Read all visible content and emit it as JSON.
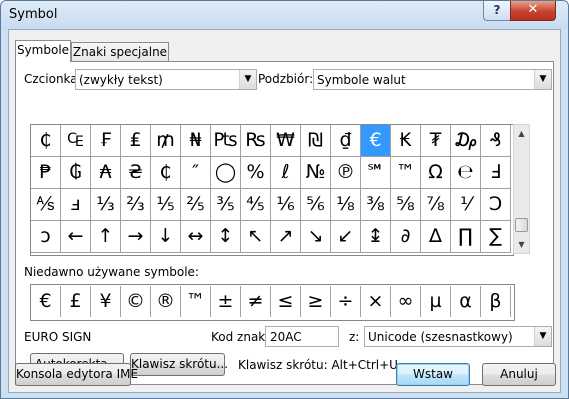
{
  "window": {
    "title": "Symbol",
    "help_label": "?",
    "close_label": "✕"
  },
  "tabs": [
    {
      "label": "Symbole",
      "active": true
    },
    {
      "label": "Znaki specjalne",
      "active": false
    }
  ],
  "font": {
    "label": "Czcionka:",
    "value": "(zwykły tekst)"
  },
  "subset": {
    "label": "Podzbiór:",
    "value": "Symbole walut"
  },
  "symbol_grid": {
    "selected_index": 11,
    "rows": [
      [
        "₵",
        "₠",
        "₣",
        "₤",
        "₥",
        "₦",
        "₧",
        "₨",
        "₩",
        "₪",
        "₫",
        "€",
        "₭",
        "₮",
        "₯",
        "₰"
      ],
      [
        "₱",
        "₲",
        "₳",
        "₴",
        "₵",
        "″",
        "◯",
        "%",
        "ℓ",
        "№",
        "℗",
        "℠",
        "™",
        "Ω",
        "℮",
        "Ⅎ"
      ],
      [
        "⅍",
        "ⅎ",
        "⅓",
        "⅔",
        "⅕",
        "⅖",
        "⅗",
        "⅘",
        "⅙",
        "⅚",
        "⅛",
        "⅜",
        "⅝",
        "⅞",
        "⅟",
        "Ↄ"
      ],
      [
        "ↄ",
        "←",
        "↑",
        "→",
        "↓",
        "↔",
        "↕",
        "↖",
        "↗",
        "↘",
        "↙",
        "↨",
        "∂",
        "∆",
        "∏",
        "∑"
      ]
    ]
  },
  "recent": {
    "label": "Niedawno używane symbole:",
    "symbols": [
      "€",
      "£",
      "¥",
      "©",
      "®",
      "™",
      "±",
      "≠",
      "≤",
      "≥",
      "÷",
      "×",
      "∞",
      "µ",
      "α",
      "β"
    ]
  },
  "char_name": "EURO SIGN",
  "char_code": {
    "label": "Kod znaku:",
    "value": "20AC"
  },
  "from": {
    "label": "z:",
    "value": "Unicode (szesnastkowy)"
  },
  "buttons": {
    "autocorrect": "Autokorekta...",
    "shortcut_key": "Klawisz skrótu...",
    "ime": "Konsola edytora IME",
    "insert": "Wstaw",
    "cancel": "Anuluj"
  },
  "shortcut_text": "Klawisz skrótu: Alt+Ctrl+U"
}
